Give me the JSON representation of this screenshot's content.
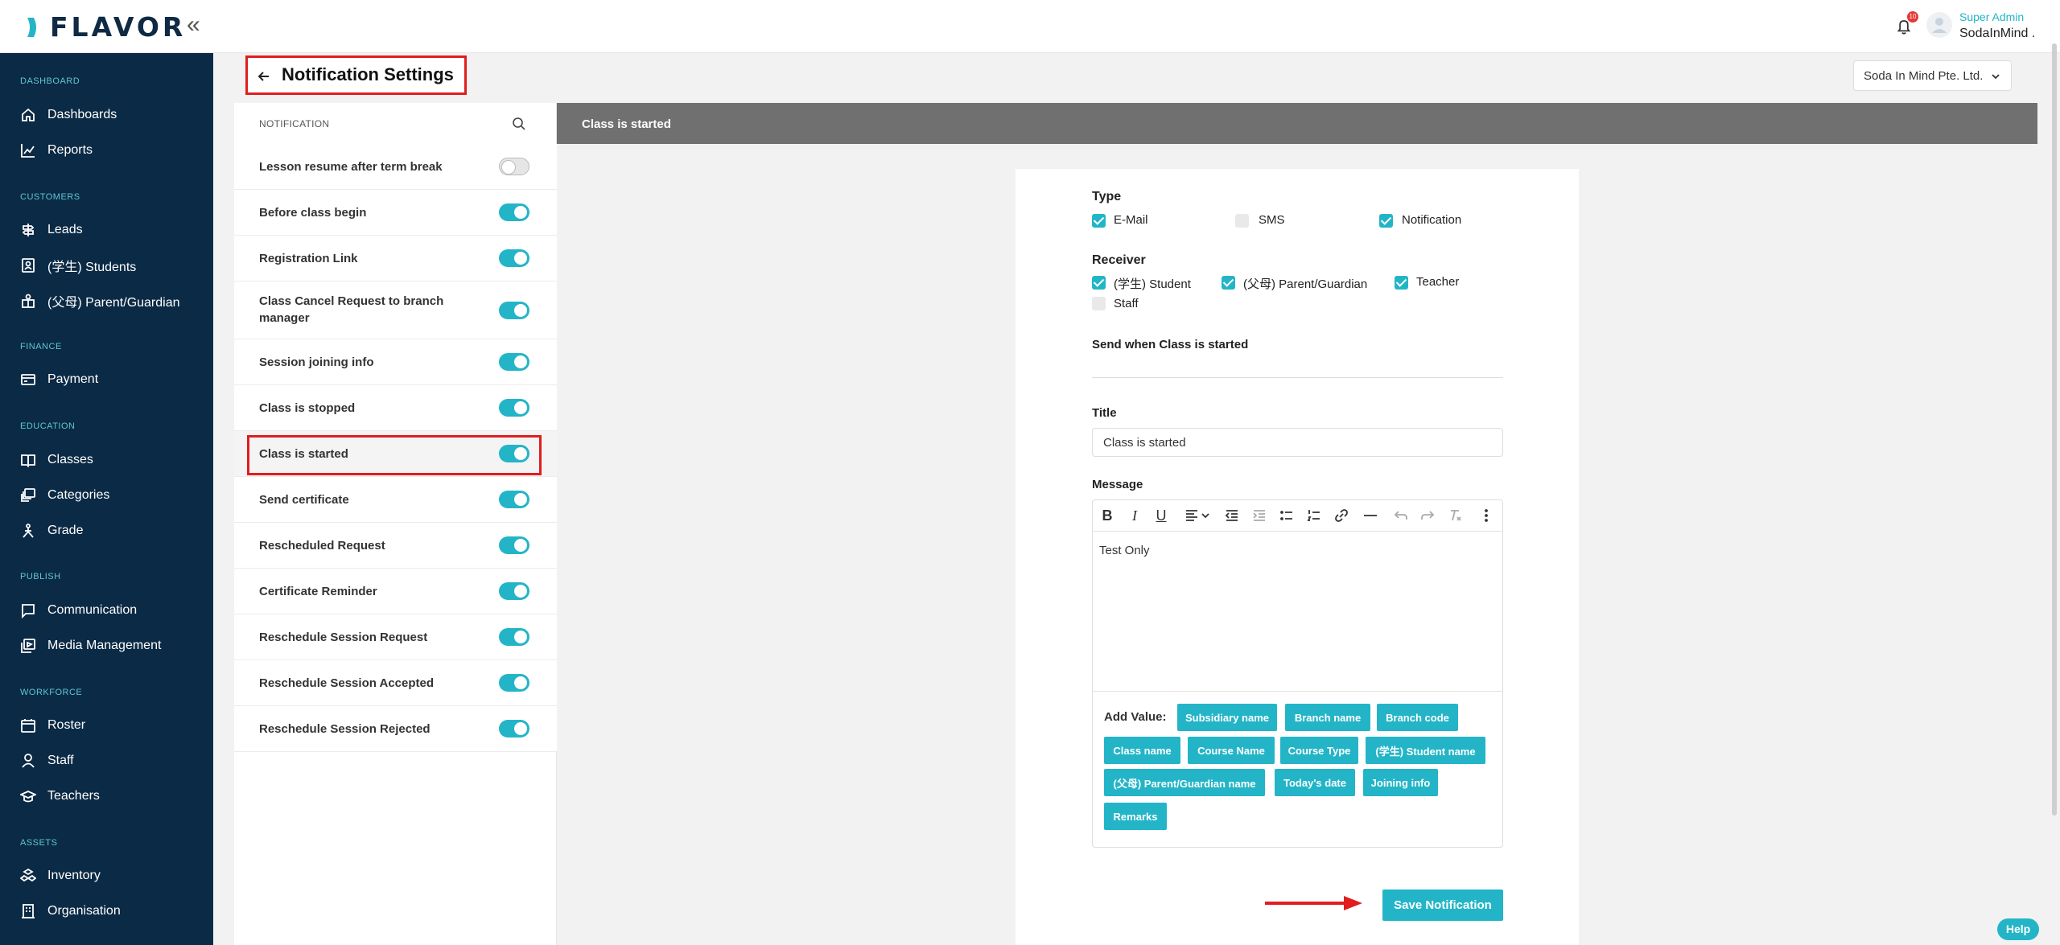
{
  "app": {
    "brand": "FLAVOR",
    "collapse_glyph": "«"
  },
  "topbar": {
    "notif_count": "10",
    "user_role": "Super Admin",
    "user_name": "SodaInMind ."
  },
  "sidebar": {
    "sections": [
      {
        "label": "DASHBOARD",
        "items": [
          {
            "label": "Dashboards",
            "icon": "home-icon"
          },
          {
            "label": "Reports",
            "icon": "chart-line-icon"
          }
        ]
      },
      {
        "label": "CUSTOMERS",
        "items": [
          {
            "label": "Leads",
            "icon": "signpost-icon"
          },
          {
            "label": "(学生) Students",
            "icon": "student-id-icon"
          },
          {
            "label": "(父母) Parent/Guardian",
            "icon": "parent-icon"
          }
        ]
      },
      {
        "label": "FINANCE",
        "items": [
          {
            "label": "Payment",
            "icon": "payment-card-icon"
          }
        ]
      },
      {
        "label": "EDUCATION",
        "items": [
          {
            "label": "Classes",
            "icon": "book-icon"
          },
          {
            "label": "Categories",
            "icon": "layers-icon"
          },
          {
            "label": "Grade",
            "icon": "grade-icon"
          }
        ]
      },
      {
        "label": "PUBLISH",
        "items": [
          {
            "label": "Communication",
            "icon": "chat-icon"
          },
          {
            "label": "Media Management",
            "icon": "media-icon"
          }
        ]
      },
      {
        "label": "WORKFORCE",
        "items": [
          {
            "label": "Roster",
            "icon": "calendar-icon"
          },
          {
            "label": "Staff",
            "icon": "person-icon"
          },
          {
            "label": "Teachers",
            "icon": "graduation-cap-icon"
          }
        ]
      },
      {
        "label": "ASSETS",
        "items": [
          {
            "label": "Inventory",
            "icon": "boxes-icon"
          },
          {
            "label": "Organisation",
            "icon": "building-icon"
          }
        ]
      }
    ]
  },
  "page": {
    "title": "Notification Settings",
    "company": "Soda In Mind Pte. Ltd."
  },
  "notification_list": {
    "header": "NOTIFICATION",
    "items": [
      {
        "label": "Lesson resume after term break",
        "enabled": false
      },
      {
        "label": "Before class begin",
        "enabled": true
      },
      {
        "label": "Registration Link",
        "enabled": true
      },
      {
        "label": "Class Cancel Request to branch manager",
        "enabled": true
      },
      {
        "label": "Session joining info",
        "enabled": true
      },
      {
        "label": "Class is stopped",
        "enabled": true
      },
      {
        "label": "Class is started",
        "enabled": true,
        "selected": true
      },
      {
        "label": "Send certificate",
        "enabled": true
      },
      {
        "label": "Rescheduled Request",
        "enabled": true
      },
      {
        "label": "Certificate Reminder",
        "enabled": true
      },
      {
        "label": "Reschedule Session Request",
        "enabled": true
      },
      {
        "label": "Reschedule Session Accepted",
        "enabled": true
      },
      {
        "label": "Reschedule Session Rejected",
        "enabled": true
      }
    ]
  },
  "detail": {
    "header": "Class is started",
    "type_label": "Type",
    "types": [
      {
        "label": "E-Mail",
        "checked": true
      },
      {
        "label": "SMS",
        "checked": false
      },
      {
        "label": "Notification",
        "checked": true
      }
    ],
    "receiver_label": "Receiver",
    "receivers": [
      {
        "label": "(学生) Student",
        "checked": true
      },
      {
        "label": "(父母) Parent/Guardian",
        "checked": true
      },
      {
        "label": "Teacher",
        "checked": true
      },
      {
        "label": "Staff",
        "checked": false
      }
    ],
    "send_when": "Send when Class is started",
    "title_label": "Title",
    "title_value": "Class is started",
    "message_label": "Message",
    "message_text": "Test Only",
    "add_value_label": "Add Value:",
    "chips": [
      "Subsidiary name",
      "Branch name",
      "Branch code",
      "Class name",
      "Course Name",
      "Course Type",
      "(学生) Student name",
      "(父母) Parent/Guardian name",
      "Today's date",
      "Joining info",
      "Remarks"
    ],
    "save_label": "Save Notification"
  },
  "help_label": "Help",
  "colors": {
    "accent": "#23b5c7",
    "sidebar": "#0b2a45",
    "highlight": "#e11d1d"
  }
}
